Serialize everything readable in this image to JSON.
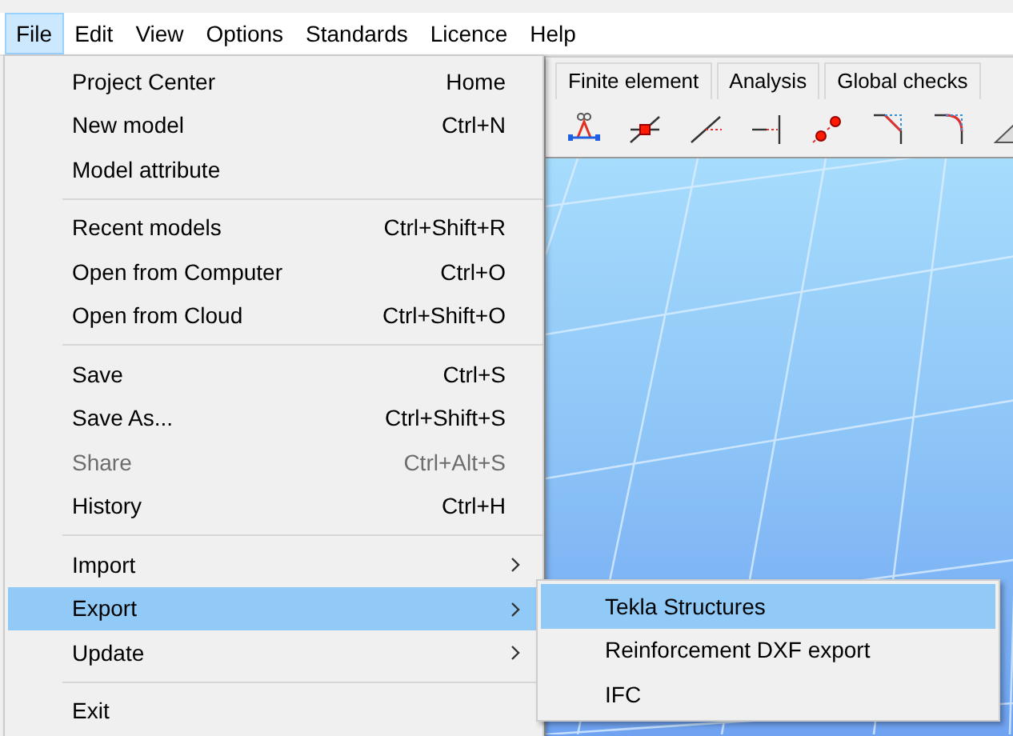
{
  "menu_bar": {
    "items": [
      {
        "label": "File",
        "selected": true
      },
      {
        "label": "Edit",
        "selected": false
      },
      {
        "label": "View",
        "selected": false
      },
      {
        "label": "Options",
        "selected": false
      },
      {
        "label": "Standards",
        "selected": false
      },
      {
        "label": "Licence",
        "selected": false
      },
      {
        "label": "Help",
        "selected": false
      }
    ]
  },
  "tabs": [
    {
      "label": "Finite element",
      "selected": false
    },
    {
      "label": "Analysis",
      "selected": false
    },
    {
      "label": "Global checks",
      "selected": false
    }
  ],
  "file_menu": {
    "groups": [
      [
        {
          "label": "Project Center",
          "shortcut": "Home",
          "kind": "command",
          "disabled": false,
          "selected": false
        },
        {
          "label": "New model",
          "shortcut": "Ctrl+N",
          "kind": "command",
          "disabled": false,
          "selected": false
        },
        {
          "label": "Model attribute",
          "kind": "command",
          "disabled": false,
          "selected": false
        }
      ],
      [
        {
          "label": "Recent models",
          "shortcut": "Ctrl+Shift+R",
          "kind": "command",
          "disabled": false,
          "selected": false
        },
        {
          "label": "Open from Computer",
          "shortcut": "Ctrl+O",
          "kind": "command",
          "disabled": false,
          "selected": false
        },
        {
          "label": "Open from Cloud",
          "shortcut": "Ctrl+Shift+O",
          "kind": "command",
          "disabled": false,
          "selected": false
        }
      ],
      [
        {
          "label": "Save",
          "shortcut": "Ctrl+S",
          "kind": "command",
          "disabled": false,
          "selected": false
        },
        {
          "label": "Save As...",
          "shortcut": "Ctrl+Shift+S",
          "kind": "command",
          "disabled": false,
          "selected": false
        },
        {
          "label": "Share",
          "shortcut": "Ctrl+Alt+S",
          "kind": "command",
          "disabled": true,
          "selected": false
        },
        {
          "label": "History",
          "shortcut": "Ctrl+H",
          "kind": "command",
          "disabled": false,
          "selected": false
        }
      ],
      [
        {
          "label": "Import",
          "kind": "submenu",
          "disabled": false,
          "selected": false
        },
        {
          "label": "Export",
          "kind": "submenu",
          "disabled": false,
          "selected": true
        },
        {
          "label": "Update",
          "kind": "submenu",
          "disabled": false,
          "selected": false
        }
      ],
      [
        {
          "label": "Exit",
          "kind": "command",
          "disabled": false,
          "selected": false
        }
      ]
    ]
  },
  "export_submenu": {
    "items": [
      {
        "label": "Tekla Structures",
        "selected": true
      },
      {
        "label": "Reinforcement DXF export",
        "selected": false
      },
      {
        "label": "IFC",
        "selected": false
      }
    ]
  }
}
